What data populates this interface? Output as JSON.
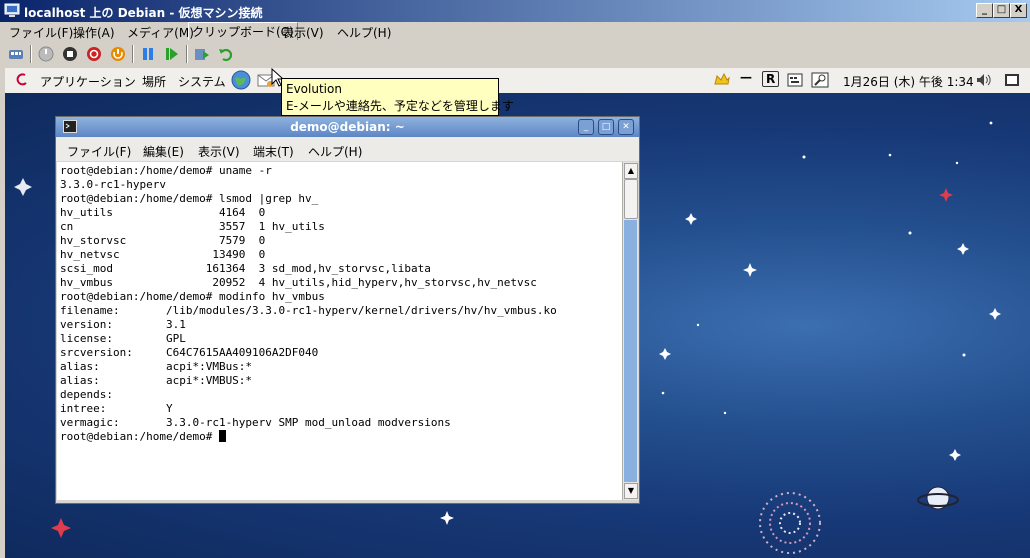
{
  "host": {
    "title": "localhost 上の Debian  - 仮想マシン接続",
    "menu": [
      "ファイル(F)",
      "操作(A)",
      "メディア(M)",
      "クリップボード(C)",
      "表示(V)",
      "ヘルプ(H)"
    ],
    "window_buttons": [
      "_",
      "□",
      "X"
    ]
  },
  "panel": {
    "applications": "アプリケーション",
    "places": "場所",
    "system": "システム",
    "clock": "1月26日 (木) 午後 1:34"
  },
  "tooltip": {
    "title": "Evolution",
    "description": "E-メールや連絡先、予定などを管理します"
  },
  "terminal": {
    "title": "demo@debian: ~",
    "menu": [
      "ファイル(F)",
      "編集(E)",
      "表示(V)",
      "端末(T)",
      "ヘルプ(H)"
    ],
    "lines": [
      "root@debian:/home/demo# uname -r",
      "3.3.0-rc1-hyperv",
      "root@debian:/home/demo# lsmod |grep hv_",
      "hv_utils                4164  0",
      "cn                      3557  1 hv_utils",
      "hv_storvsc              7579  0",
      "hv_netvsc              13490  0",
      "scsi_mod              161364  3 sd_mod,hv_storvsc,libata",
      "hv_vmbus               20952  4 hv_utils,hid_hyperv,hv_storvsc,hv_netvsc",
      "root@debian:/home/demo# modinfo hv_vmbus",
      "filename:       /lib/modules/3.3.0-rc1-hyperv/kernel/drivers/hv/hv_vmbus.ko",
      "version:        3.1",
      "license:        GPL",
      "srcversion:     C64C7615AA409106A2DF040",
      "alias:          acpi*:VMBus:*",
      "alias:          acpi*:VMBUS:*",
      "depends:        ",
      "intree:         Y",
      "vermagic:       3.3.0-rc1-hyperv SMP mod_unload modversions"
    ],
    "prompt": "root@debian:/home/demo# "
  }
}
